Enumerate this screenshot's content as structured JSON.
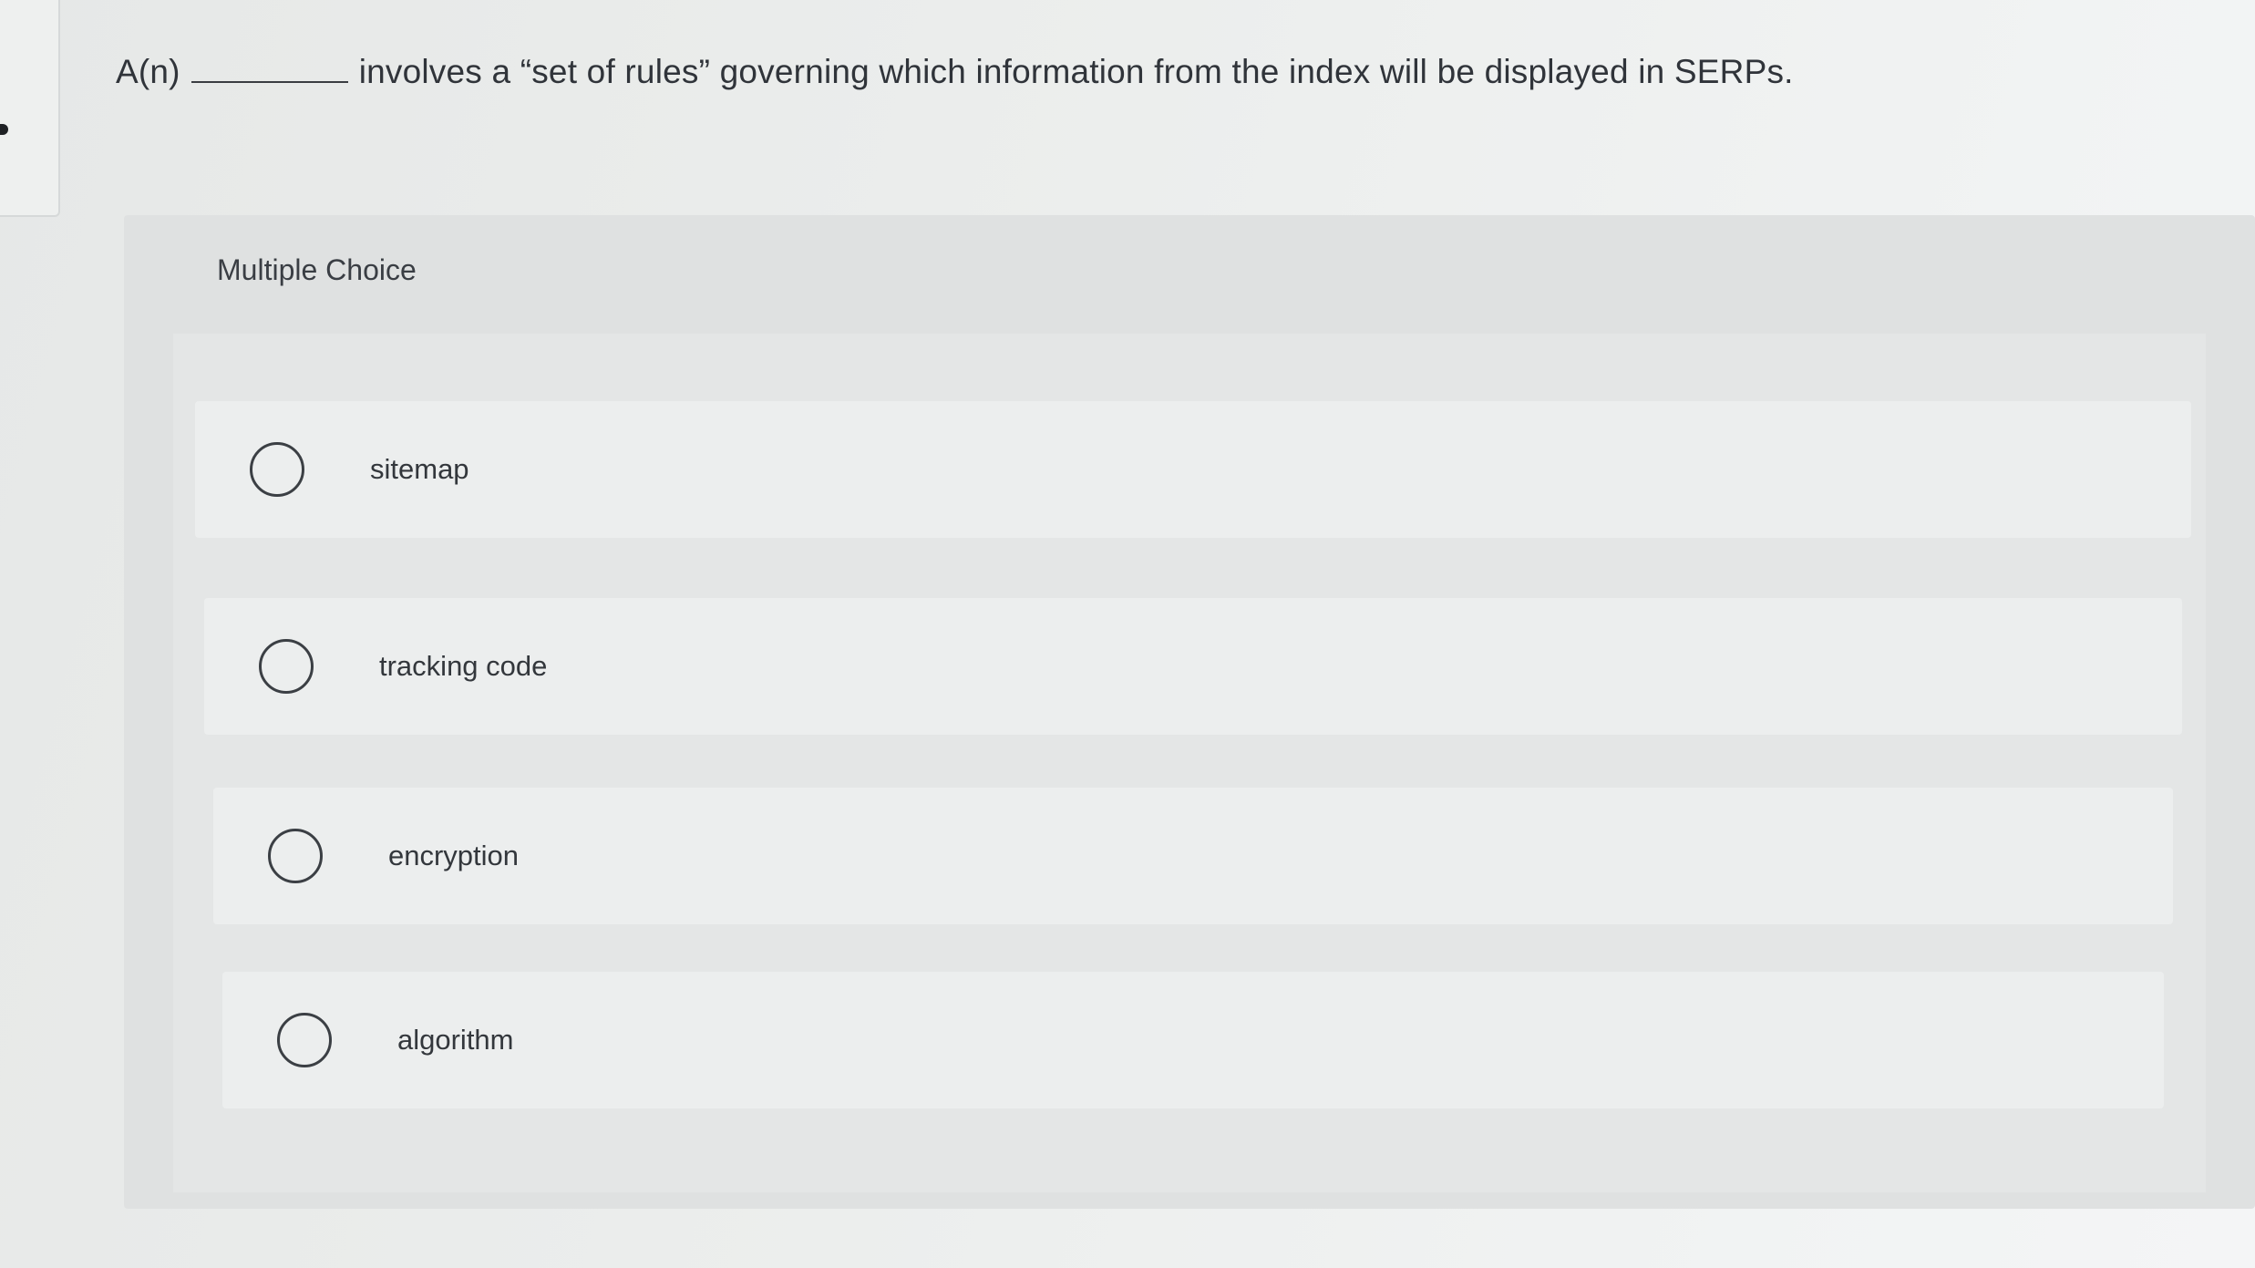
{
  "question": {
    "prefix": "A(n)",
    "suffix": "involves a “set of rules” governing which information from the index will be displayed in SERPs."
  },
  "multiple_choice": {
    "header": "Multiple Choice",
    "options": [
      {
        "label": "sitemap"
      },
      {
        "label": "tracking code"
      },
      {
        "label": "encryption"
      },
      {
        "label": "algorithm"
      }
    ]
  }
}
